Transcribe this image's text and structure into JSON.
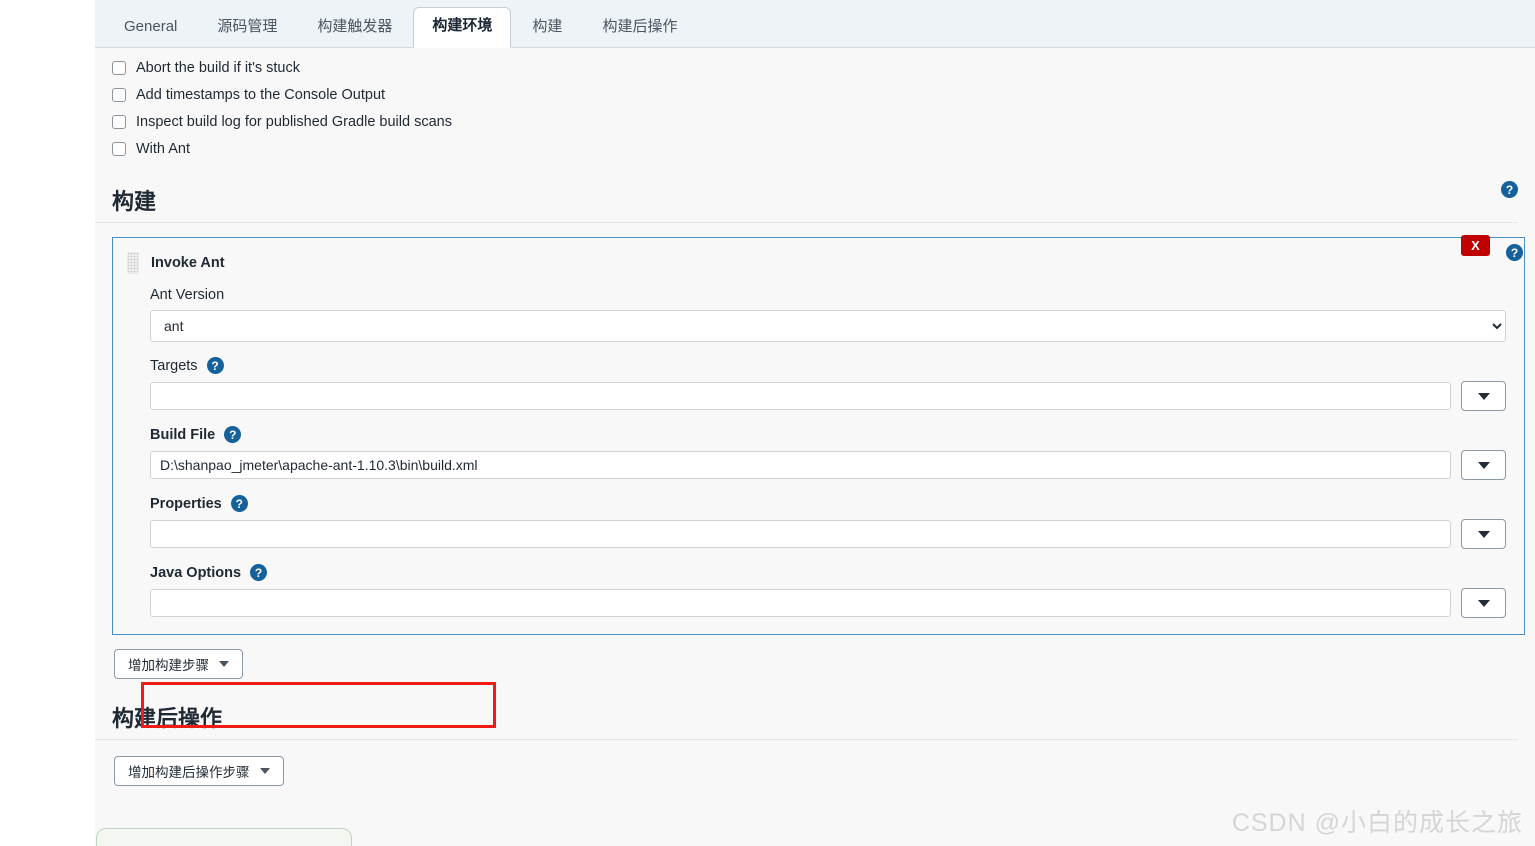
{
  "tabs": [
    {
      "label": "General",
      "active": false
    },
    {
      "label": "源码管理",
      "active": false
    },
    {
      "label": "构建触发器",
      "active": false
    },
    {
      "label": "构建环境",
      "active": true
    },
    {
      "label": "构建",
      "active": false
    },
    {
      "label": "构建后操作",
      "active": false
    }
  ],
  "build_env": {
    "checkboxes": [
      {
        "label": "Abort the build if it's stuck",
        "checked": false
      },
      {
        "label": "Add timestamps to the Console Output",
        "checked": false
      },
      {
        "label": "Inspect build log for published Gradle build scans",
        "checked": false
      },
      {
        "label": "With Ant",
        "checked": false
      }
    ],
    "help_icon": "help-icon"
  },
  "build_section": {
    "heading": "构建",
    "step": {
      "title": "Invoke Ant",
      "grip_icon": "drag-handle-icon",
      "delete_label": "X",
      "help_icon": "help-icon",
      "ant_version": {
        "label": "Ant Version",
        "value": "ant",
        "options": [
          "ant"
        ]
      },
      "targets": {
        "label": "Targets",
        "value": "",
        "placeholder": "",
        "help_icon": "help-icon",
        "dropdown_icon": "triangle-down-icon"
      },
      "build_file": {
        "label": "Build File",
        "value": "D:\\shanpao_jmeter\\apache-ant-1.10.3\\bin\\build.xml",
        "placeholder": "",
        "help_icon": "help-icon",
        "dropdown_icon": "triangle-down-icon",
        "highlighted": true
      },
      "properties": {
        "label": "Properties",
        "value": "",
        "placeholder": "",
        "help_icon": "help-icon",
        "dropdown_icon": "triangle-down-icon"
      },
      "java_options": {
        "label": "Java Options",
        "value": "",
        "placeholder": "",
        "help_icon": "help-icon",
        "dropdown_icon": "triangle-down-icon"
      }
    },
    "add_step_button": "增加构建步骤"
  },
  "post_build_section": {
    "heading": "构建后操作",
    "add_step_button": "增加构建后操作步骤"
  },
  "watermark": "CSDN @小白的成长之旅",
  "colors": {
    "accent_blue": "#15619c",
    "panel_border": "#4a90c4",
    "delete_red": "#c00000",
    "annotation_red": "#ee1c15",
    "page_bg": "#f8f8f8",
    "tabbar_bg": "#eef3f7"
  }
}
